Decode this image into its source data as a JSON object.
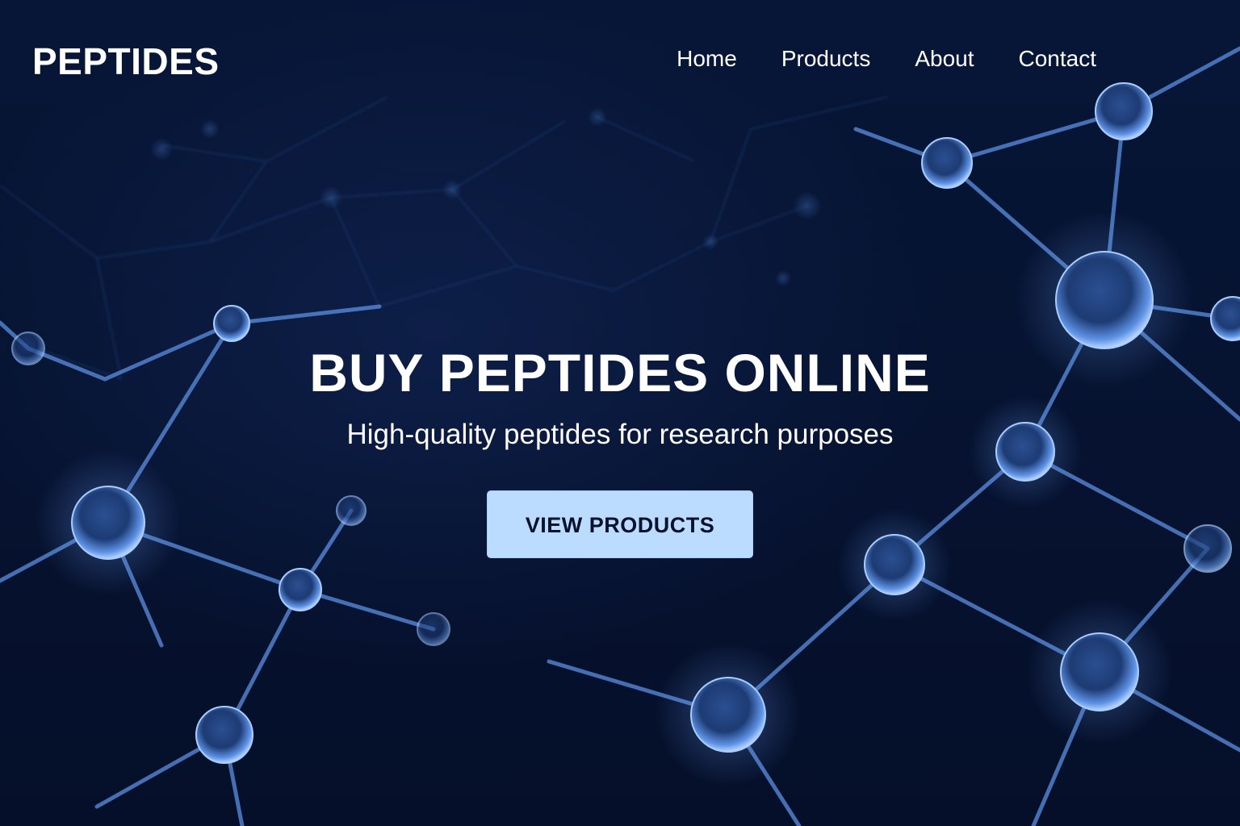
{
  "header": {
    "logo": "PEPTIDES",
    "nav": [
      {
        "label": "Home"
      },
      {
        "label": "Products"
      },
      {
        "label": "About"
      },
      {
        "label": "Contact"
      }
    ]
  },
  "hero": {
    "title": "BUY PEPTIDES ONLINE",
    "subtitle": "High-quality peptides for research purposes",
    "cta_label": "VIEW PRODUCTS"
  },
  "background": {
    "description_icon": "molecule-network-icon",
    "colors": {
      "base": "#061331",
      "node": "#7fb0ff",
      "button": "#bcdcff"
    }
  }
}
